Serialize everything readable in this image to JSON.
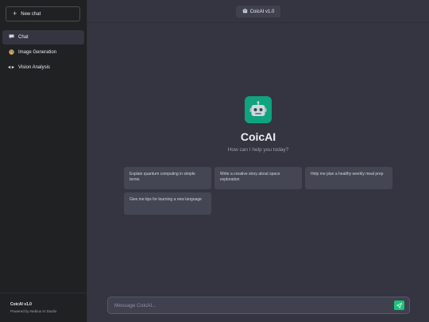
{
  "sidebar": {
    "new_chat_label": "New chat",
    "items": [
      {
        "label": "Chat",
        "icon": "chat-bubble-icon",
        "active": true
      },
      {
        "label": "Image Generation",
        "icon": "palette-icon",
        "active": false
      },
      {
        "label": "Vision Analysis",
        "icon": "eye-icon",
        "active": false
      }
    ],
    "footer": {
      "title": "CoicAI v1.0",
      "subtitle": "Powered by Nebius AI Studio"
    }
  },
  "header": {
    "version_label": "CoicAI v1.0",
    "icon": "robot-icon"
  },
  "welcome": {
    "logo_icon": "robot-icon",
    "title": "CoicAI",
    "subtitle": "How can I help you today?"
  },
  "suggestions": [
    "Explain quantum computing in simple terms",
    "Write a creative story about space exploration",
    "Help me plan a healthy weekly meal prep",
    "Give me tips for learning a new language"
  ],
  "composer": {
    "placeholder": "Message CoicAI...",
    "value": ""
  },
  "colors": {
    "accent": "#10a37f",
    "send": "#19c37d",
    "sidebar_bg": "#202123",
    "main_bg": "#343541"
  }
}
